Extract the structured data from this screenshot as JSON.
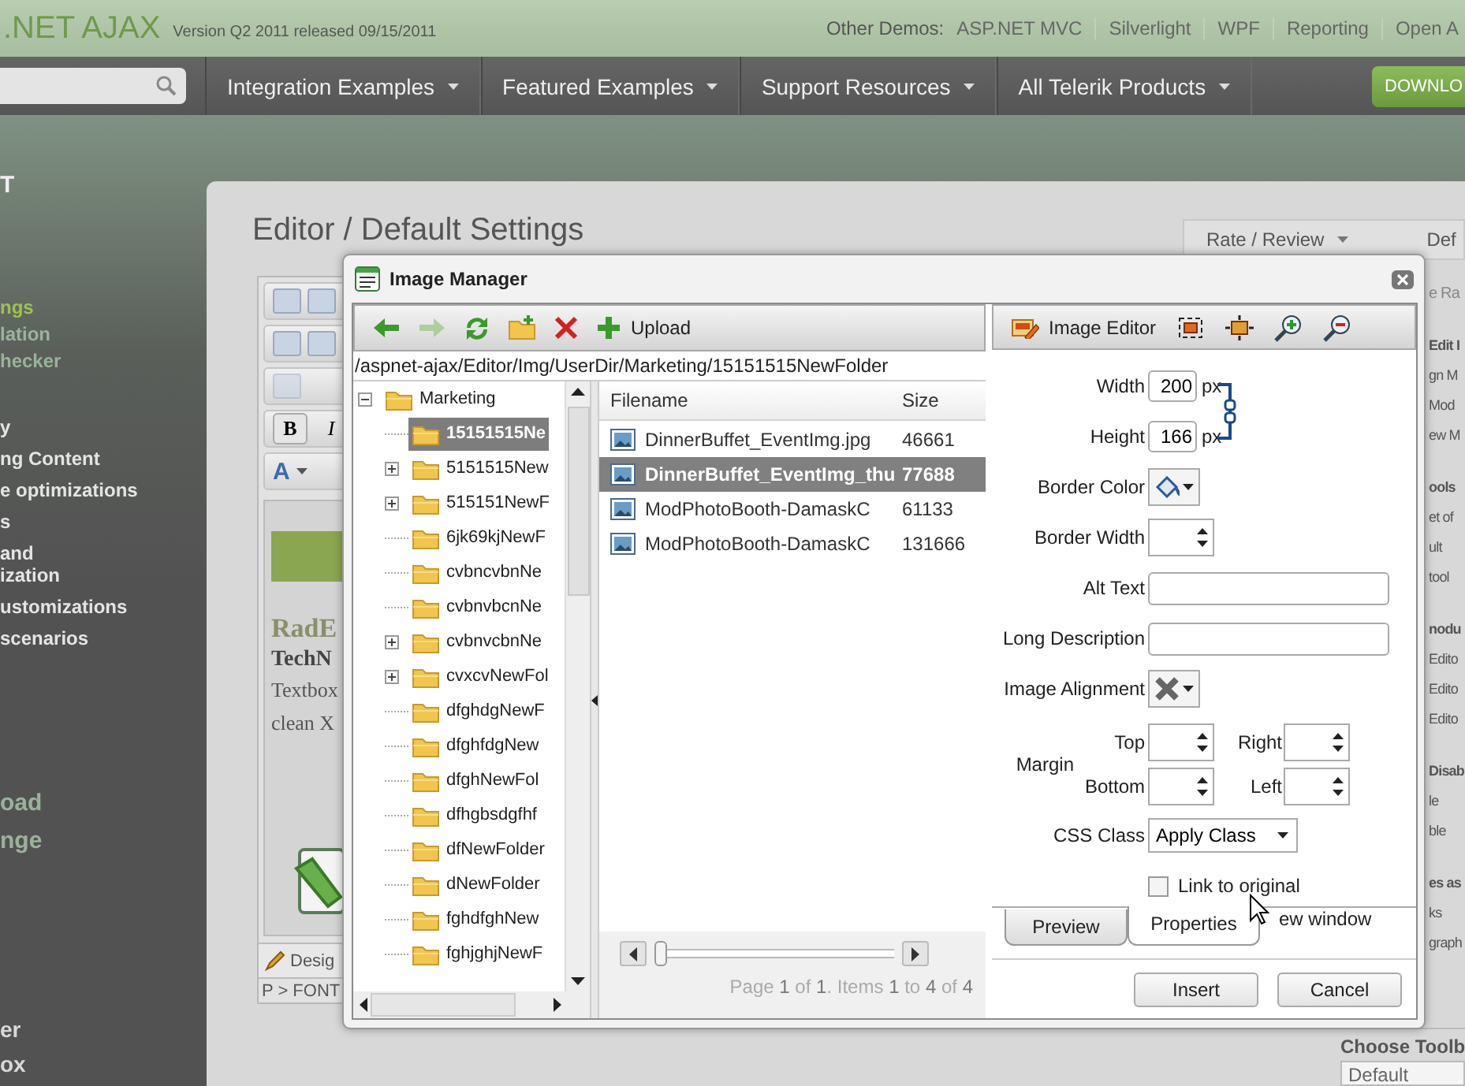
{
  "header": {
    "logo": ".NET AJAX",
    "version": "Version Q2 2011 released 09/15/2011",
    "demos_label": "Other Demos:",
    "demo_links": [
      "ASP.NET MVC",
      "Silverlight",
      "WPF",
      "Reporting",
      "Open A"
    ]
  },
  "nav": {
    "items": [
      "Integration Examples",
      "Featured Examples",
      "Support Resources",
      "All Telerik Products"
    ],
    "download": "DOWNLO"
  },
  "sidebar": {
    "groups": [
      {
        "kind": "title",
        "items": [
          {
            "label": "T",
            "selected": false
          }
        ]
      },
      {
        "kind": "sub",
        "items": [
          {
            "label": "ngs",
            "selected": true
          },
          {
            "label": "lation",
            "selected": false
          },
          {
            "label": "hecker",
            "selected": false
          }
        ]
      },
      {
        "kind": "main",
        "items": [
          {
            "label": "y",
            "selected": false
          },
          {
            "label": "ng Content",
            "selected": false
          },
          {
            "label": "e optimizations",
            "selected": false
          },
          {
            "label": "s",
            "selected": false
          },
          {
            "label": "and\nization",
            "selected": false
          },
          {
            "label": "ustomizations",
            "selected": false
          },
          {
            "label": "scenarios",
            "selected": false
          }
        ]
      },
      {
        "kind": "section",
        "items": [
          {
            "label": "oad",
            "selected": false
          },
          {
            "label": "nge",
            "selected": false
          }
        ]
      },
      {
        "kind": "footer",
        "items": [
          {
            "label": "er",
            "selected": false
          },
          {
            "label": "ox",
            "selected": false
          }
        ]
      }
    ]
  },
  "main": {
    "title": "Editor / Default Settings",
    "editor": {
      "format_buttons": [
        "B",
        "I"
      ],
      "color_button": "A",
      "heading": "RadE",
      "subheading": "TechN",
      "lines": [
        "Textbox",
        "clean X"
      ],
      "mode_tab": "Desig",
      "breadcrumb": "P > FONT"
    },
    "rate": "Rate / Review",
    "rate_next": "Def",
    "side_groups": [
      [
        "e Ra"
      ],
      [
        "Edit I",
        "gn M",
        "Mod",
        "ew M"
      ],
      [
        "ools",
        "et of",
        "ult",
        "tool"
      ],
      [
        "nodu",
        "Edito",
        "Edito",
        "Edito"
      ],
      [
        "Disab",
        "le",
        "ble"
      ],
      [
        "es as",
        "ks",
        "graph"
      ]
    ],
    "toolbar_chooser": {
      "label": "Choose Toolb",
      "value": "Default"
    }
  },
  "dialog": {
    "title": "Image Manager",
    "toolbar": [
      {
        "kind": "back",
        "disabled": false
      },
      {
        "kind": "forward",
        "disabled": true
      },
      {
        "kind": "refresh",
        "disabled": false
      },
      {
        "kind": "new-folder",
        "disabled": false
      },
      {
        "kind": "delete",
        "disabled": false
      },
      {
        "kind": "upload",
        "label": "Upload",
        "disabled": false
      }
    ],
    "path": "/aspnet-ajax/Editor/Img/UserDir/Marketing/15151515NewFolder",
    "tree": {
      "label": "Marketing",
      "expanded": true,
      "selected": false,
      "children": [
        {
          "label": "15151515Ne",
          "selected": true
        },
        {
          "label": "5151515New",
          "expanded": false,
          "selected": false
        },
        {
          "label": "515151NewF",
          "expanded": false,
          "selected": false
        },
        {
          "label": "6jk69kjNewF",
          "selected": false
        },
        {
          "label": "cvbncvbnNe",
          "selected": false
        },
        {
          "label": "cvbnvbcnNe",
          "selected": false
        },
        {
          "label": "cvbnvcbnNe",
          "expanded": false,
          "selected": false
        },
        {
          "label": "cvxcvNewFol",
          "expanded": false,
          "selected": false
        },
        {
          "label": "dfghdgNewF",
          "selected": false
        },
        {
          "label": "dfghfdgNew",
          "selected": false
        },
        {
          "label": "dfghNewFol",
          "selected": false
        },
        {
          "label": "dfhgbsdgfhf",
          "selected": false
        },
        {
          "label": "dfNewFolder",
          "selected": false
        },
        {
          "label": "dNewFolder",
          "selected": false
        },
        {
          "label": "fghdfghNew",
          "selected": false
        },
        {
          "label": "fghjghjNewF",
          "selected": false
        }
      ]
    },
    "files": {
      "columns": [
        "Filename",
        "Size"
      ],
      "rows": [
        {
          "name": "DinnerBuffet_EventImg.jpg",
          "size": "46661",
          "selected": false
        },
        {
          "name": "DinnerBuffet_EventImg_thu",
          "size": "77688",
          "selected": true
        },
        {
          "name": "ModPhotoBooth-DamaskC",
          "size": "61133",
          "selected": false
        },
        {
          "name": "ModPhotoBooth-DamaskC",
          "size": "131666",
          "selected": false
        }
      ]
    },
    "pager": {
      "level": 0,
      "text": "Page **1** of **1**. Items **1** to **4** of **4**"
    },
    "editor_toolbar": {
      "label": "Image Editor",
      "tools": [
        {
          "kind": "frame"
        },
        {
          "kind": "resize"
        },
        {
          "kind": "zoom-in"
        },
        {
          "kind": "zoom-out"
        }
      ]
    },
    "form": {
      "width": {
        "label": "Width",
        "value": "200",
        "unit": "px"
      },
      "height": {
        "label": "Height",
        "value": "166",
        "unit": "px"
      },
      "border_color": {
        "label": "Border Color"
      },
      "border_width": {
        "label": "Border Width"
      },
      "alt_text": {
        "label": "Alt Text"
      },
      "long_description": {
        "label": "Long Description"
      },
      "image_alignment": {
        "label": "Image Alignment"
      },
      "margin": {
        "label": "Margin",
        "top": "Top",
        "right": "Right",
        "bottom": "Bottom",
        "left": "Left"
      },
      "css_class": {
        "label": "CSS Class",
        "value": "Apply Class"
      },
      "link_original": {
        "label": "Link to original",
        "checked": false
      },
      "hidden_option": "ew window"
    },
    "tabs": [
      {
        "label": "Preview",
        "selected": false
      },
      {
        "label": "Properties",
        "selected": true
      }
    ],
    "buttons": [
      "Insert",
      "Cancel"
    ]
  }
}
